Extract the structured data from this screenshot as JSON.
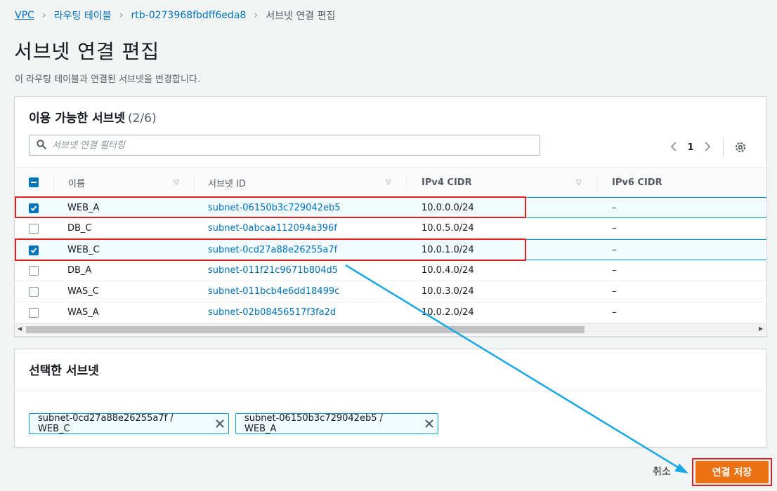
{
  "breadcrumb": {
    "items": [
      "VPC",
      "라우팅 테이블",
      "rtb-0273968fbdff6eda8"
    ],
    "current": "서브넷 연결 편집"
  },
  "page": {
    "title": "서브넷 연결 편집",
    "description": "이 라우팅 테이블과 연결된 서브넷을 변경합니다."
  },
  "available": {
    "title": "이용 가능한 서브넷",
    "count": "(2/6)",
    "search_placeholder": "서브넷 연결 필터링",
    "page_number": "1",
    "columns": [
      "이름",
      "서브넷 ID",
      "IPv4 CIDR",
      "IPv6 CIDR"
    ],
    "rows": [
      {
        "checked": true,
        "name": "WEB_A",
        "subnet_id": "subnet-06150b3c729042eb5",
        "ipv4": "10.0.0.0/24",
        "ipv6": "–"
      },
      {
        "checked": false,
        "name": "DB_C",
        "subnet_id": "subnet-0abcaa112094a396f",
        "ipv4": "10.0.5.0/24",
        "ipv6": "–"
      },
      {
        "checked": true,
        "name": "WEB_C",
        "subnet_id": "subnet-0cd27a88e26255a7f",
        "ipv4": "10.0.1.0/24",
        "ipv6": "–"
      },
      {
        "checked": false,
        "name": "DB_A",
        "subnet_id": "subnet-011f21c9671b804d5",
        "ipv4": "10.0.4.0/24",
        "ipv6": "–"
      },
      {
        "checked": false,
        "name": "WAS_C",
        "subnet_id": "subnet-011bcb4e6dd18499c",
        "ipv4": "10.0.3.0/24",
        "ipv6": "–"
      },
      {
        "checked": false,
        "name": "WAS_A",
        "subnet_id": "subnet-02b08456517f3fa2d",
        "ipv4": "10.0.2.0/24",
        "ipv6": "–"
      }
    ]
  },
  "selected": {
    "title": "선택한 서브넷",
    "tokens": [
      "subnet-0cd27a88e26255a7f / WEB_C",
      "subnet-06150b3c729042eb5 / WEB_A"
    ]
  },
  "actions": {
    "cancel": "취소",
    "save": "연결 저장"
  },
  "colors": {
    "accent": "#ec7211",
    "link": "#0073bb",
    "highlight": "#e02020",
    "annotation_arrow": "#1aa7e6"
  }
}
